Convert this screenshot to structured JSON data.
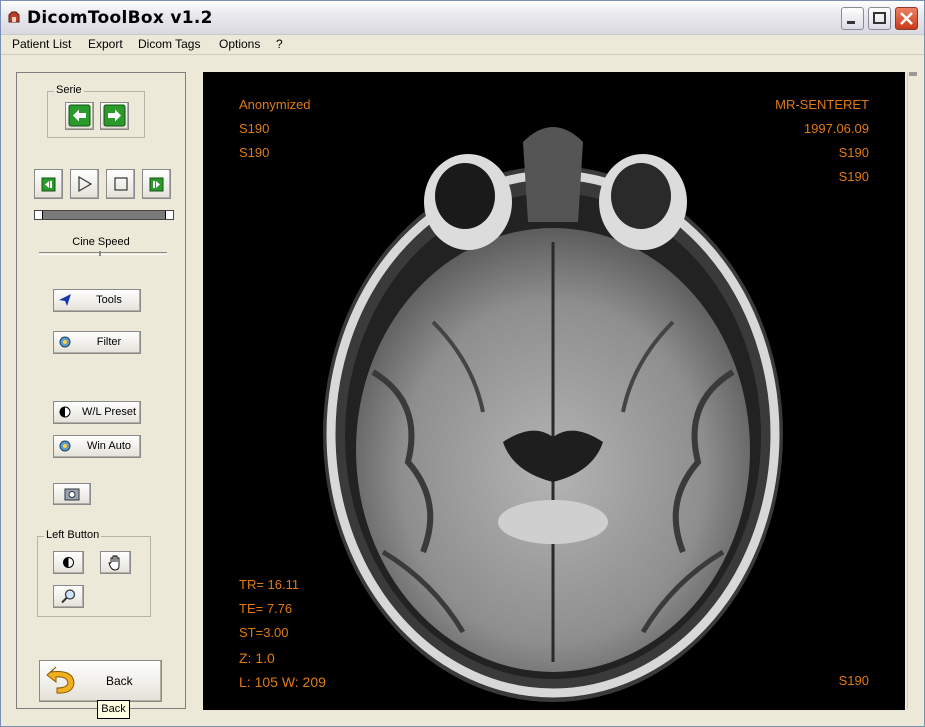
{
  "window": {
    "title": "DicomToolBox v1.2"
  },
  "menu": [
    "Patient List",
    "Export",
    "Dicom Tags",
    "Options",
    "?"
  ],
  "left_panel": {
    "serie_label": "Serie",
    "cine_speed_label": "Cine Speed",
    "tools_label": "Tools",
    "filter_label": "Filter",
    "wl_preset_label": "W/L Preset",
    "win_auto_label": "Win Auto",
    "left_button_label": "Left Button",
    "back_label": "Back"
  },
  "overlay": {
    "top_left": [
      "Anonymized",
      "S190",
      "S190"
    ],
    "top_right": [
      "MR-SENTERET",
      "1997.06.09",
      "S190",
      "S190"
    ],
    "bottom_left": [
      "TR= 16.11",
      "TE= 7.76",
      "ST=3.00",
      "Z: 1.0",
      "L: 105 W: 209"
    ],
    "bottom_right": "S190"
  },
  "tooltip": "Back",
  "colors": {
    "overlay_text": "#e07a10",
    "arrow_green": "#2a9a2a",
    "background": "#ECE9D8"
  }
}
